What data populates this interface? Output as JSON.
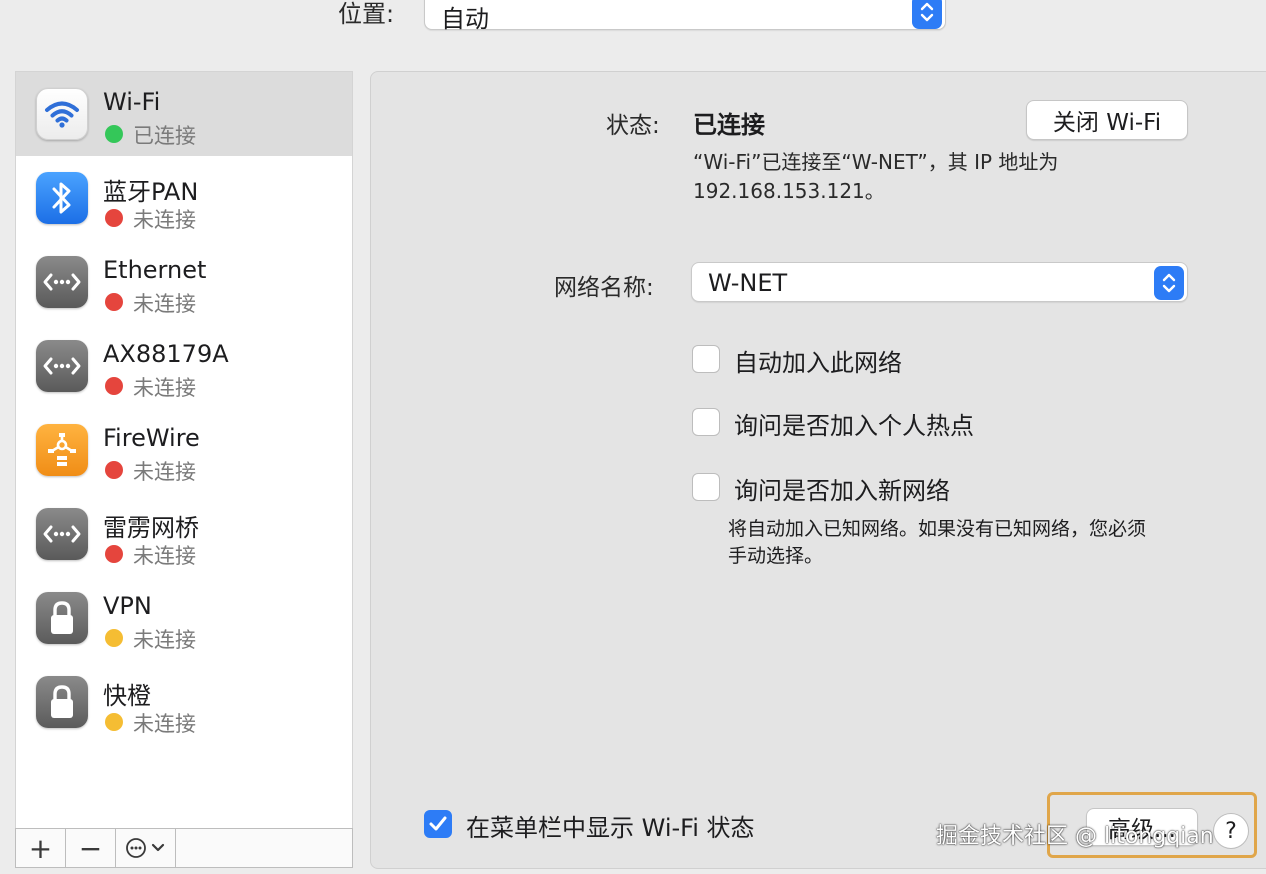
{
  "location": {
    "label": "位置:",
    "value": "自动"
  },
  "services": [
    {
      "name": "Wi-Fi",
      "status": "已连接",
      "status_color": "#34c759",
      "icon": "wifi-icon",
      "selected": true
    },
    {
      "name": "蓝牙PAN",
      "status": "未连接",
      "status_color": "#e5453d",
      "icon": "bluetooth-icon"
    },
    {
      "name": "Ethernet",
      "status": "未连接",
      "status_color": "#e5453d",
      "icon": "ethernet-icon"
    },
    {
      "name": "AX88179A",
      "status": "未连接",
      "status_color": "#e5453d",
      "icon": "ethernet-icon"
    },
    {
      "name": "FireWire",
      "status": "未连接",
      "status_color": "#e5453d",
      "icon": "firewire-icon"
    },
    {
      "name": "雷雳网桥",
      "status": "未连接",
      "status_color": "#e5453d",
      "icon": "ethernet-icon"
    },
    {
      "name": "VPN",
      "status": "未连接",
      "status_color": "#f5bd33",
      "icon": "lock-icon"
    },
    {
      "name": "快橙",
      "status": "未连接",
      "status_color": "#f5bd33",
      "icon": "lock-icon"
    }
  ],
  "toolbar": {
    "add": "+",
    "remove": "−"
  },
  "panel": {
    "status_label": "状态:",
    "status_value": "已连接",
    "turn_off_button": "关闭 Wi-Fi",
    "status_desc_1": "“Wi-Fi”已连接至“W-NET”，其 IP 地址为",
    "status_desc_2": "192.168.153.121。",
    "network_label": "网络名称:",
    "network_value": "W-NET",
    "checkboxes": [
      {
        "label": "自动加入此网络",
        "checked": false
      },
      {
        "label": "询问是否加入个人热点",
        "checked": false
      },
      {
        "label": "询问是否加入新网络",
        "checked": false
      }
    ],
    "note_1": "将自动加入已知网络。如果没有已知网络，您必须",
    "note_2": "手动选择。",
    "show_in_menubar": "在菜单栏中显示 Wi-Fi 状态",
    "advanced_button": "高级...",
    "help_button": "?"
  },
  "watermark": "掘金技术社区 @ litongqian",
  "colors": {
    "accent": "#2d7cf6",
    "highlight": "#e0a64a"
  }
}
